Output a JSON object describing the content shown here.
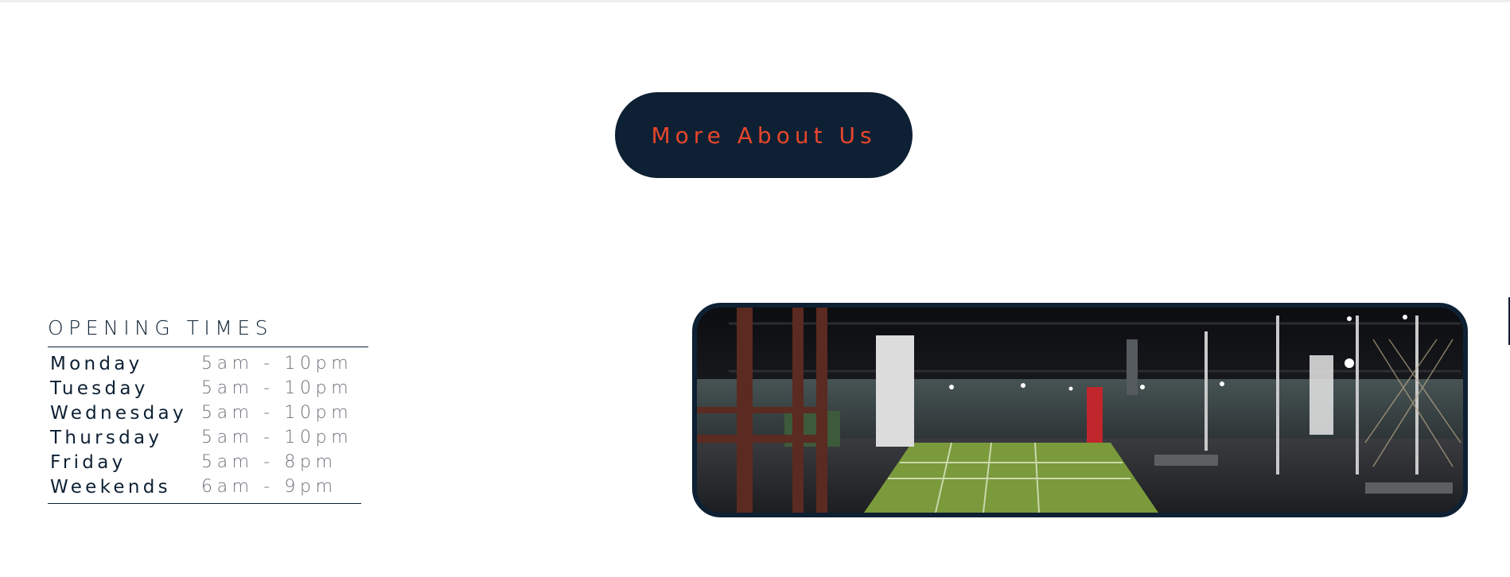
{
  "cta": {
    "label": "More About Us"
  },
  "opening_times": {
    "title": "OPENING TIMES",
    "rows": [
      {
        "day": "Monday",
        "hours": "5am - 10pm"
      },
      {
        "day": "Tuesday",
        "hours": "5am - 10pm"
      },
      {
        "day": "Wednesday",
        "hours": "5am - 10pm"
      },
      {
        "day": "Thursday",
        "hours": "5am - 10pm"
      },
      {
        "day": "Friday",
        "hours": "5am - 8pm"
      },
      {
        "day": "Weekends",
        "hours": "6am - 9pm"
      }
    ]
  },
  "photo": {
    "subject": "gym interior panorama"
  },
  "colors": {
    "navy": "#0e2033",
    "accent": "#e8462c",
    "muted": "#6b6f78",
    "turf": "#7a9a3c"
  }
}
